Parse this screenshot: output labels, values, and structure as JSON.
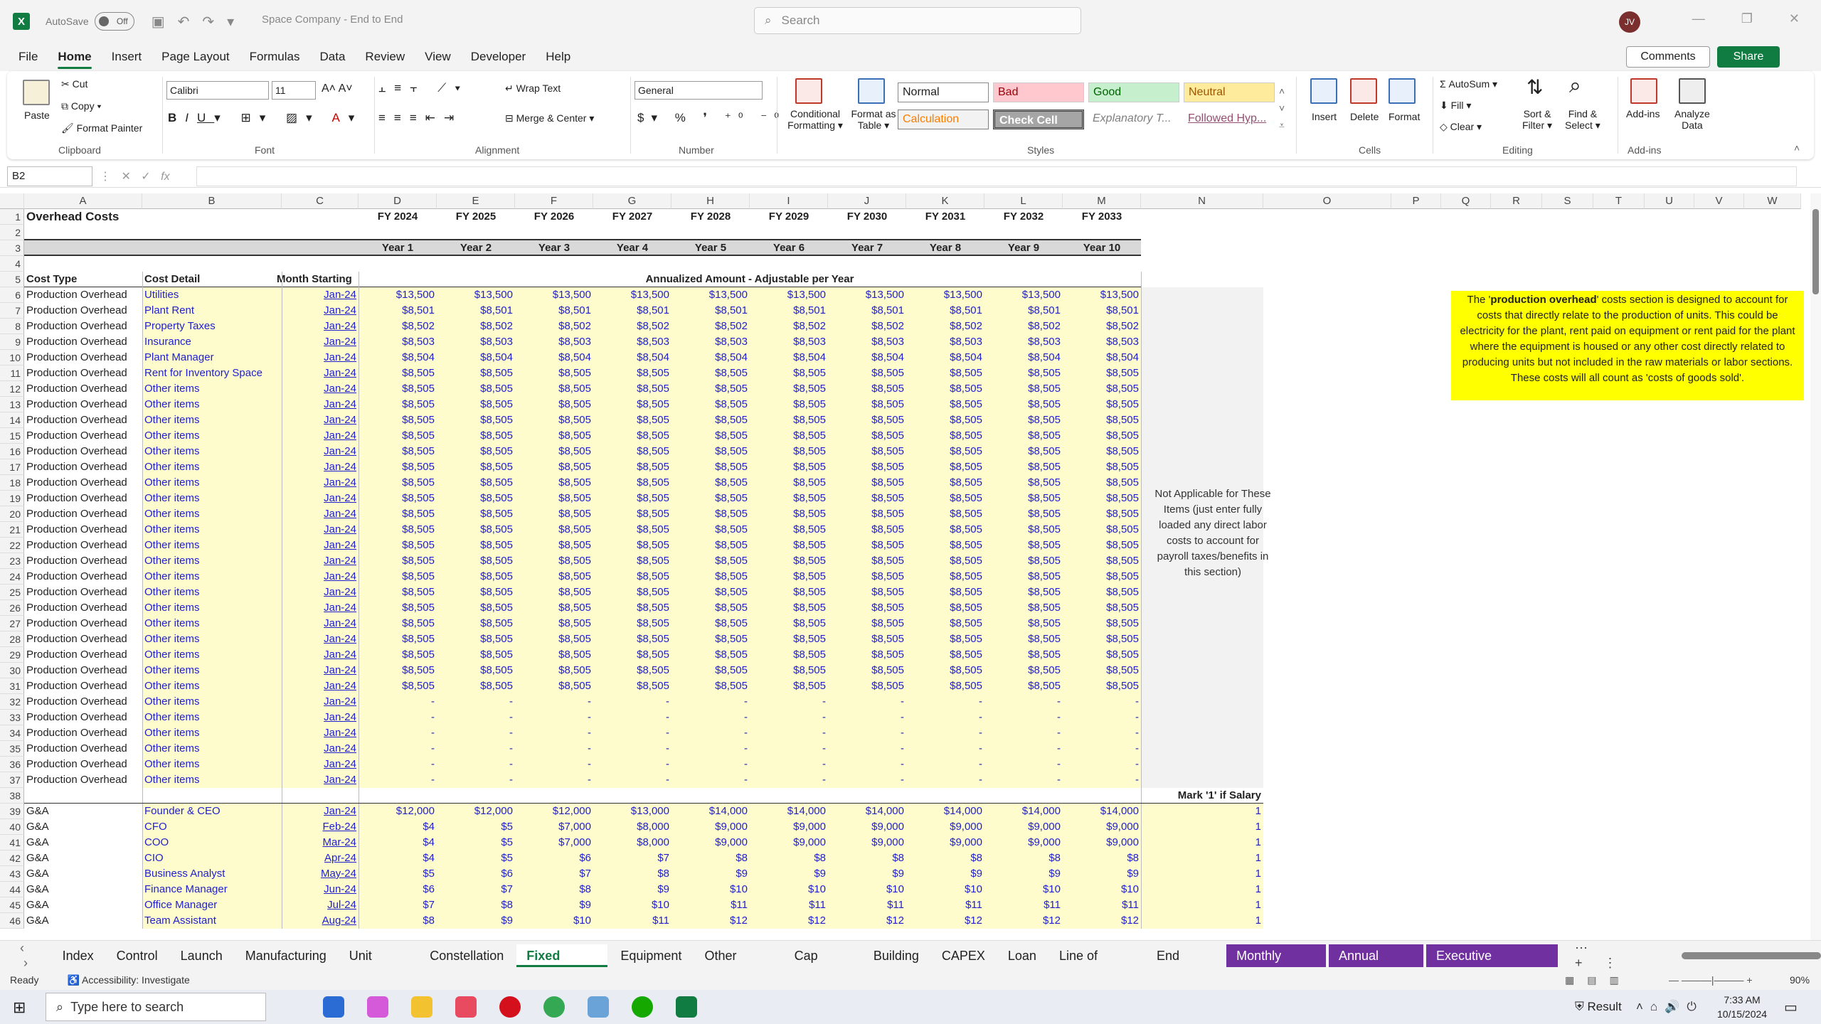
{
  "titlebar": {
    "autosave": "AutoSave",
    "toggle": "Off",
    "doc_title": "Space Company - End to End",
    "search_placeholder": "Search",
    "avatar": "JV"
  },
  "ribbon_tabs": [
    "File",
    "Home",
    "Insert",
    "Page Layout",
    "Formulas",
    "Data",
    "Review",
    "View",
    "Developer",
    "Help"
  ],
  "actions": {
    "comments": "Comments",
    "share": "Share"
  },
  "ribbon": {
    "clipboard": {
      "paste": "Paste",
      "cut": "Cut",
      "copy": "Copy",
      "format_painter": "Format Painter",
      "group": "Clipboard"
    },
    "font": {
      "name": "Calibri",
      "size": "11",
      "group": "Font"
    },
    "alignment": {
      "wrap": "Wrap Text",
      "merge": "Merge & Center",
      "group": "Alignment"
    },
    "number": {
      "format": "General",
      "group": "Number"
    },
    "styles": {
      "conditional": "Conditional",
      "formatting": "Formatting",
      "format_as": "Format as",
      "table": "Table",
      "normal": "Normal",
      "bad": "Bad",
      "good": "Good",
      "neutral": "Neutral",
      "calculation": "Calculation",
      "check": "Check Cell",
      "explanatory": "Explanatory T...",
      "followed": "Followed Hyp...",
      "group": "Styles"
    },
    "cells": {
      "insert": "Insert",
      "delete": "Delete",
      "format": "Format",
      "group": "Cells"
    },
    "editing": {
      "autosum": "AutoSum",
      "fill": "Fill",
      "clear": "Clear",
      "sort": "Sort &",
      "filter": "Filter",
      "find": "Find &",
      "select": "Select",
      "group": "Editing"
    },
    "addins": {
      "addins": "Add-ins",
      "analyze": "Analyze",
      "data": "Data",
      "group": "Add-ins"
    }
  },
  "formula_bar": {
    "name_box": "B2",
    "fx": "fx"
  },
  "columns": [
    "A",
    "B",
    "C",
    "D",
    "E",
    "F",
    "G",
    "H",
    "I",
    "J",
    "K",
    "L",
    "M",
    "N",
    "O",
    "P",
    "Q",
    "R",
    "S",
    "T",
    "U",
    "V",
    "W"
  ],
  "sheet": {
    "title": "Overhead Costs",
    "fy": [
      "FY 2024",
      "FY 2025",
      "FY 2026",
      "FY 2027",
      "FY 2028",
      "FY 2029",
      "FY 2030",
      "FY 2031",
      "FY 2032",
      "FY 2033"
    ],
    "years": [
      "Year 1",
      "Year 2",
      "Year 3",
      "Year 4",
      "Year 5",
      "Year 6",
      "Year 7",
      "Year 8",
      "Year 9",
      "Year 10"
    ],
    "hdr_type": "Cost Type",
    "hdr_detail": "Cost Detail",
    "hdr_month": "Month Starting",
    "hdr_annual": "Annualized Amount - Adjustable per Year",
    "po": "Production Overhead",
    "po_rows": [
      {
        "d": "Utilities",
        "v": "$13,500"
      },
      {
        "d": "Plant Rent",
        "v": "$8,501"
      },
      {
        "d": "Property Taxes",
        "v": "$8,502"
      },
      {
        "d": "Insurance",
        "v": "$8,503"
      },
      {
        "d": "Plant Manager",
        "v": "$8,504"
      },
      {
        "d": "Rent for Inventory Space",
        "v": "$8,505"
      }
    ],
    "other": "Other items",
    "other_val": "$8,505",
    "dash": "-",
    "month": "Jan-24",
    "salary_hdr": "Mark '1' if Salary",
    "ga": "G&A",
    "ga_rows": [
      {
        "d": "Founder & CEO",
        "m": "Jan-24",
        "v": [
          "$12,000",
          "$12,000",
          "$12,000",
          "$13,000",
          "$14,000",
          "$14,000",
          "$14,000",
          "$14,000",
          "$14,000",
          "$14,000"
        ]
      },
      {
        "d": "CFO",
        "m": "Feb-24",
        "v": [
          "$4",
          "$5",
          "$7,000",
          "$8,000",
          "$9,000",
          "$9,000",
          "$9,000",
          "$9,000",
          "$9,000",
          "$9,000"
        ]
      },
      {
        "d": "COO",
        "m": "Mar-24",
        "v": [
          "$4",
          "$5",
          "$7,000",
          "$8,000",
          "$9,000",
          "$9,000",
          "$9,000",
          "$9,000",
          "$9,000",
          "$9,000"
        ]
      },
      {
        "d": "CIO",
        "m": "Apr-24",
        "v": [
          "$4",
          "$5",
          "$6",
          "$7",
          "$8",
          "$8",
          "$8",
          "$8",
          "$8",
          "$8"
        ]
      },
      {
        "d": "Business Analyst",
        "m": "May-24",
        "v": [
          "$5",
          "$6",
          "$7",
          "$8",
          "$9",
          "$9",
          "$9",
          "$9",
          "$9",
          "$9"
        ]
      },
      {
        "d": "Finance Manager",
        "m": "Jun-24",
        "v": [
          "$6",
          "$7",
          "$8",
          "$9",
          "$10",
          "$10",
          "$10",
          "$10",
          "$10",
          "$10"
        ]
      },
      {
        "d": "Office Manager",
        "m": "Jul-24",
        "v": [
          "$7",
          "$8",
          "$9",
          "$10",
          "$11",
          "$11",
          "$11",
          "$11",
          "$11",
          "$11"
        ]
      },
      {
        "d": "Team Assistant",
        "m": "Aug-24",
        "v": [
          "$8",
          "$9",
          "$10",
          "$11",
          "$12",
          "$12",
          "$12",
          "$12",
          "$12",
          "$12"
        ]
      }
    ],
    "salary_flag": "1",
    "note_pre": "The '",
    "note_bold": "production overhead",
    "note_post": "' costs section is designed to account for costs that directly relate to the production of units. This could be electricity for the plant, rent paid on equipment or rent paid for the plant where the equipment is housed or any other cost directly related to producing units but not included in the raw materials or labor sections. These costs will all count as 'costs of goods sold'.",
    "na_text": "Not Applicable for These Items (just enter fully loaded any direct labor costs to account for payroll taxes/benefits in this section)"
  },
  "sheet_tabs": [
    "Index",
    "Control",
    "Launch",
    "Manufacturing",
    "Unit Costs",
    "Constellation",
    "Fixed Costs",
    "Equipment",
    "Other Costs",
    "Cap Table",
    "Building",
    "CAPEX",
    "Loan",
    "Line of Credit",
    "End Value"
  ],
  "purple_tabs": [
    "Monthly Detail",
    "Annual Detail",
    "Executive Summary"
  ],
  "active_tab": "Fixed Costs",
  "status": {
    "ready": "Ready",
    "accessibility": "Accessibility: Investigate",
    "zoom": "90%"
  },
  "taskbar": {
    "search": "Type here to search",
    "result": "Result",
    "time": "7:33 AM",
    "date": "10/15/2024"
  }
}
